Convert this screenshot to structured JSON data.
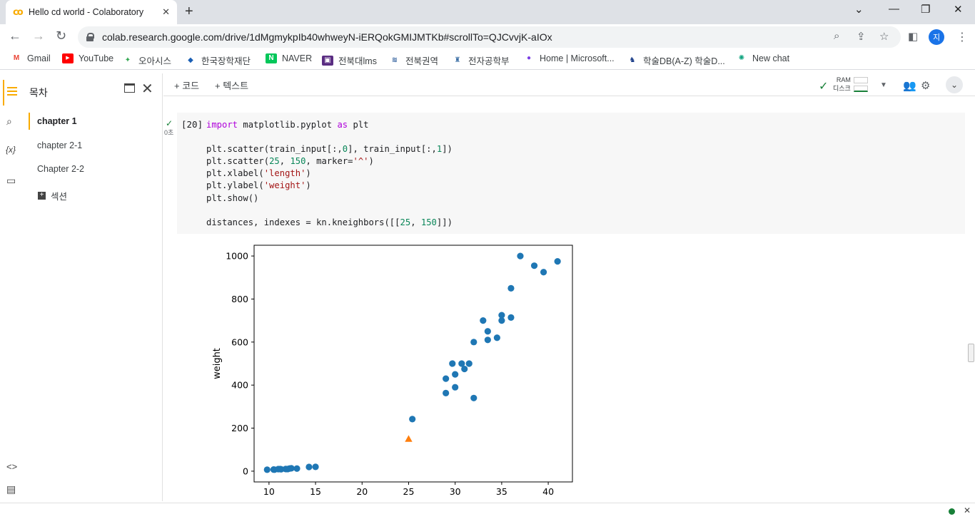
{
  "browser": {
    "tab_title": "Hello cd world - Colaboratory",
    "tab_favicon": "co",
    "url": "colab.research.google.com/drive/1dMgmykpIb40whweyN-iERQokGMIJMTKb#scrollTo=QJCvvjK-aIOx",
    "profile_initial": "지",
    "bookmarks": [
      {
        "label": "Gmail",
        "icon_color": "#ea4335",
        "glyph": "M"
      },
      {
        "label": "YouTube",
        "icon_color": "#ff0000",
        "glyph": "▶"
      },
      {
        "label": "오아시스",
        "icon_color": "#34a853",
        "glyph": "✦"
      },
      {
        "label": "한국장학재단",
        "icon_color": "#1a5fb4",
        "glyph": "◆"
      },
      {
        "label": "NAVER",
        "icon_color": "#03c75a",
        "glyph": "N"
      },
      {
        "label": "전북대lms",
        "icon_color": "#5a2d82",
        "glyph": "▣"
      },
      {
        "label": "전북권역",
        "icon_color": "#2a5a9a",
        "glyph": "≋"
      },
      {
        "label": "전자공학부",
        "icon_color": "#3b6ea5",
        "glyph": "♜"
      },
      {
        "label": "Home | Microsoft...",
        "icon_color": "#7b3fe4",
        "glyph": "●"
      },
      {
        "label": "학술DB(A-Z) 학술D...",
        "icon_color": "#1d3f8a",
        "glyph": "♞"
      },
      {
        "label": "New chat",
        "icon_color": "#10a37f",
        "glyph": "✺"
      }
    ]
  },
  "sidebar": {
    "title": "목차",
    "items": [
      {
        "label": "chapter 1",
        "active": true
      },
      {
        "label": "chapter 2-1",
        "active": false
      },
      {
        "label": "Chapter 2-2",
        "active": false
      }
    ],
    "section_label": "섹션"
  },
  "notebook_toolbar": {
    "add_code": "+ 코드",
    "add_text": "+ 텍스트",
    "ram_label": "RAM",
    "disk_label": "디스크"
  },
  "cell": {
    "exec_count": "[20]",
    "run_time": "0초"
  },
  "chart_data": {
    "type": "scatter",
    "title": "",
    "xlabel": "length",
    "ylabel": "weight",
    "xlim": [
      8.4,
      42.6
    ],
    "ylim": [
      -50,
      1050
    ],
    "xticks": [
      10,
      15,
      20,
      25,
      30,
      35,
      40
    ],
    "yticks": [
      0,
      200,
      400,
      600,
      800,
      1000
    ],
    "grid": false,
    "colors": {
      "train": "#1f77b4",
      "target": "#ff7f0e"
    },
    "series": [
      {
        "marker": "circle",
        "x": [
          9.8,
          10.5,
          10.6,
          11.0,
          11.2,
          11.3,
          11.8,
          11.8,
          12.0,
          12.2,
          12.4,
          13.0,
          14.3,
          15.0,
          25.4,
          29.0,
          29.0,
          29.7,
          30.0,
          30.0,
          30.7,
          31.0,
          31.5,
          32.0,
          32.0,
          33.0,
          33.5,
          33.5,
          34.5,
          35.0,
          35.0,
          36.0,
          36.0,
          37.0,
          38.5,
          39.5,
          41.0
        ],
        "y": [
          6.7,
          7.5,
          7.0,
          9.7,
          9.8,
          8.7,
          10.0,
          9.9,
          9.8,
          12.2,
          13.4,
          12.2,
          19.7,
          19.9,
          242,
          363,
          430,
          500,
          450,
          390,
          500,
          475,
          500,
          340,
          600,
          700,
          610,
          650,
          620,
          700,
          725,
          714,
          850,
          1000,
          955,
          925,
          975
        ]
      },
      {
        "marker": "triangle",
        "x": [
          25
        ],
        "y": [
          150
        ]
      }
    ]
  }
}
